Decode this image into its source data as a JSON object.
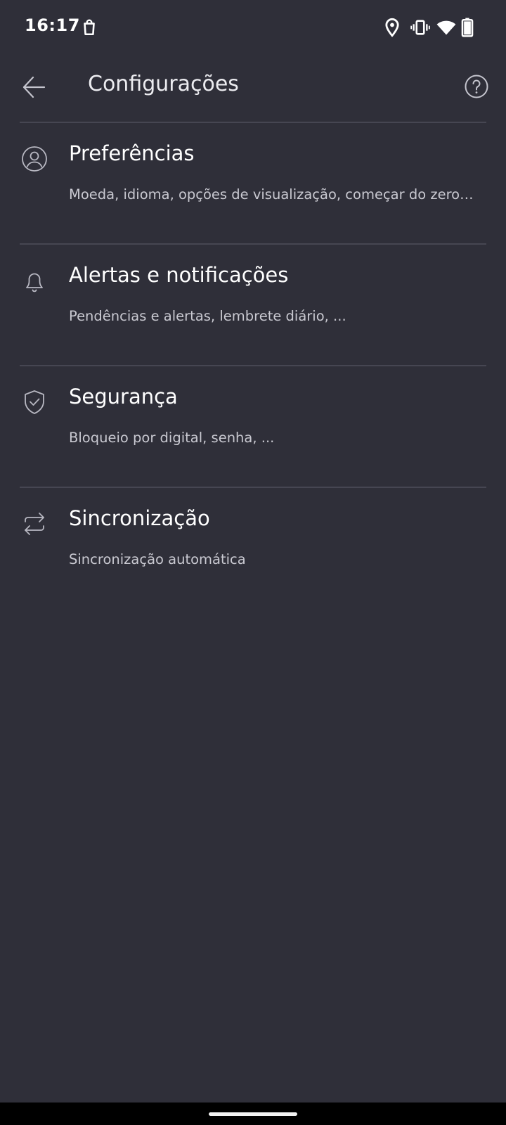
{
  "status_bar": {
    "time": "16:17",
    "icons": [
      "shopping-bag-icon",
      "location-pin-icon",
      "vibrate-icon",
      "wifi-icon",
      "battery-icon"
    ]
  },
  "app_bar": {
    "title": "Configurações",
    "back_icon": "arrow-left-icon",
    "help_icon": "help-circle-icon"
  },
  "settings": {
    "items": [
      {
        "icon": "user-circle-icon",
        "title": "Preferências",
        "subtitle": "Moeda, idioma, opções de visualização, começar do zero…"
      },
      {
        "icon": "bell-icon",
        "title": "Alertas e notificações",
        "subtitle": "Pendências e alertas, lembrete diário, ..."
      },
      {
        "icon": "shield-check-icon",
        "title": "Segurança",
        "subtitle": "Bloqueio por digital, senha, ..."
      },
      {
        "icon": "sync-arrows-icon",
        "title": "Sincronização",
        "subtitle": "Sincronização automática"
      }
    ]
  },
  "colors": {
    "background": "#2f2f39",
    "divider": "#464652",
    "title_text": "#ffffff",
    "subtitle_text": "#c9c9d1",
    "icon_stroke": "#b8b8c2",
    "nav_bar": "#000000"
  }
}
